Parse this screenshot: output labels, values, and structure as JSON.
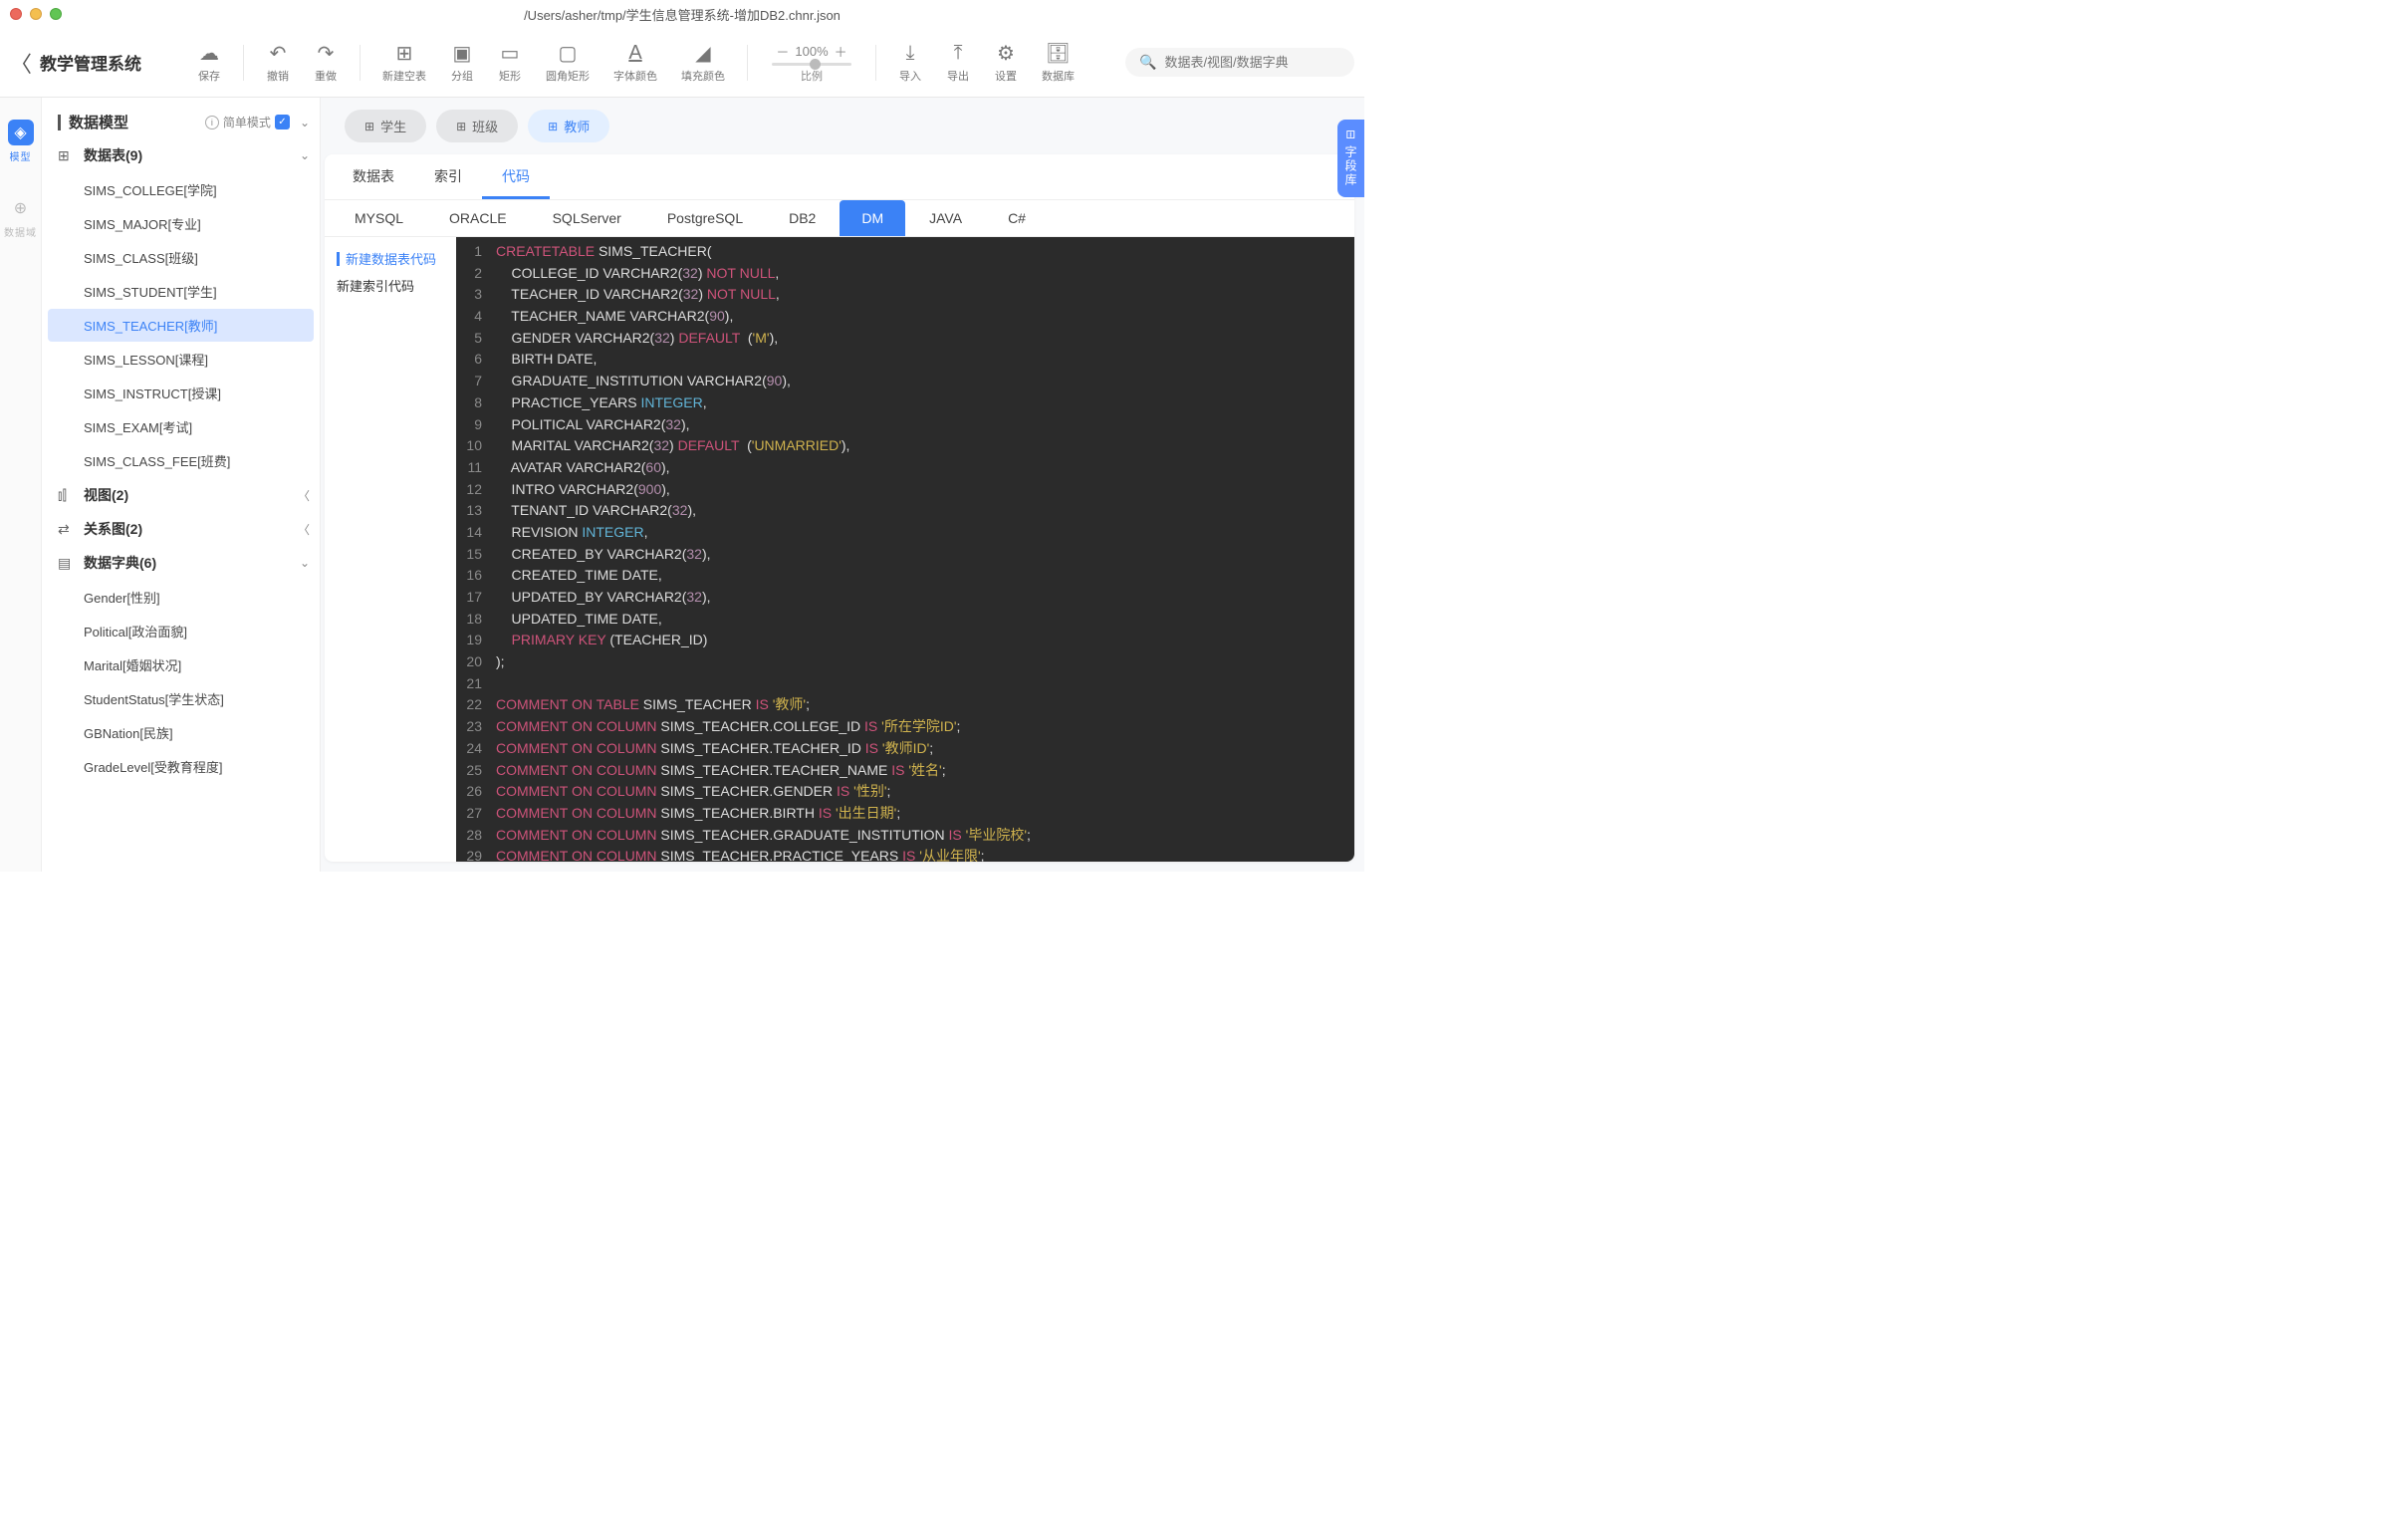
{
  "window": {
    "title": "/Users/asher/tmp/学生信息管理系统-增加DB2.chnr.json"
  },
  "back": {
    "title": "教学管理系统"
  },
  "toolbar": {
    "save": "保存",
    "undo": "撤销",
    "redo": "重做",
    "newtable": "新建空表",
    "group": "分组",
    "rect": "矩形",
    "roundrect": "圆角矩形",
    "fontcolor": "字体颜色",
    "fillcolor": "填充颜色",
    "zoom_label": "比例",
    "zoom_value": "100%",
    "import": "导入",
    "export": "导出",
    "settings": "设置",
    "database": "数据库"
  },
  "search": {
    "placeholder": "数据表/视图/数据字典"
  },
  "rail": {
    "model": "模型",
    "domain": "数据域"
  },
  "sidebar": {
    "header": "数据模型",
    "mode": "简单模式",
    "groups": {
      "tables": "数据表(9)",
      "views": "视图(2)",
      "relations": "关系图(2)",
      "dicts": "数据字典(6)"
    },
    "tables": [
      "SIMS_COLLEGE[学院]",
      "SIMS_MAJOR[专业]",
      "SIMS_CLASS[班级]",
      "SIMS_STUDENT[学生]",
      "SIMS_TEACHER[教师]",
      "SIMS_LESSON[课程]",
      "SIMS_INSTRUCT[授课]",
      "SIMS_EXAM[考试]",
      "SIMS_CLASS_FEE[班费]"
    ],
    "dicts": [
      "Gender[性别]",
      "Political[政治面貌]",
      "Marital[婚姻状况]",
      "StudentStatus[学生状态]",
      "GBNation[民族]",
      "GradeLevel[受教育程度]"
    ]
  },
  "pills": {
    "p1": "学生",
    "p2": "班级",
    "p3": "教师"
  },
  "tabs": {
    "t1": "数据表",
    "t2": "索引",
    "t3": "代码"
  },
  "dbs": [
    "MYSQL",
    "ORACLE",
    "SQLServer",
    "PostgreSQL",
    "DB2",
    "DM",
    "JAVA",
    "C#"
  ],
  "codeside": {
    "c1": "新建数据表代码",
    "c2": "新建索引代码"
  },
  "right_tab": "字段库",
  "code_lines": [
    [
      [
        "kw",
        "CREATE"
      ],
      [
        "",
        ""
      ],
      [
        "kw",
        "TABLE"
      ],
      [
        "",
        " SIMS_TEACHER("
      ]
    ],
    [
      [
        "",
        "    COLLEGE_ID VARCHAR2("
      ],
      [
        "num",
        "32"
      ],
      [
        "",
        ") "
      ],
      [
        "kw",
        "NOT"
      ],
      [
        "",
        " "
      ],
      [
        "kw",
        "NULL"
      ],
      [
        "",
        ","
      ]
    ],
    [
      [
        "",
        "    TEACHER_ID VARCHAR2("
      ],
      [
        "num",
        "32"
      ],
      [
        "",
        ") "
      ],
      [
        "kw",
        "NOT"
      ],
      [
        "",
        " "
      ],
      [
        "kw",
        "NULL"
      ],
      [
        "",
        ","
      ]
    ],
    [
      [
        "",
        "    TEACHER_NAME VARCHAR2("
      ],
      [
        "num",
        "90"
      ],
      [
        "",
        "),"
      ]
    ],
    [
      [
        "",
        "    GENDER VARCHAR2("
      ],
      [
        "num",
        "32"
      ],
      [
        "",
        ") "
      ],
      [
        "kw",
        "DEFAULT"
      ],
      [
        "",
        "  ("
      ],
      [
        "str",
        "'M'"
      ],
      [
        "",
        "),"
      ]
    ],
    [
      [
        "",
        "    BIRTH DATE,"
      ]
    ],
    [
      [
        "",
        "    GRADUATE_INSTITUTION VARCHAR2("
      ],
      [
        "num",
        "90"
      ],
      [
        "",
        "),"
      ]
    ],
    [
      [
        "",
        "    PRACTICE_YEARS "
      ],
      [
        "type",
        "INTEGER"
      ],
      [
        "",
        ","
      ]
    ],
    [
      [
        "",
        "    POLITICAL VARCHAR2("
      ],
      [
        "num",
        "32"
      ],
      [
        "",
        "),"
      ]
    ],
    [
      [
        "",
        "    MARITAL VARCHAR2("
      ],
      [
        "num",
        "32"
      ],
      [
        "",
        ") "
      ],
      [
        "kw",
        "DEFAULT"
      ],
      [
        "",
        "  ("
      ],
      [
        "str",
        "'UNMARRIED'"
      ],
      [
        "",
        "),"
      ]
    ],
    [
      [
        "",
        "    AVATAR VARCHAR2("
      ],
      [
        "num",
        "60"
      ],
      [
        "",
        "),"
      ]
    ],
    [
      [
        "",
        "    INTRO VARCHAR2("
      ],
      [
        "num",
        "900"
      ],
      [
        "",
        "),"
      ]
    ],
    [
      [
        "",
        "    TENANT_ID VARCHAR2("
      ],
      [
        "num",
        "32"
      ],
      [
        "",
        "),"
      ]
    ],
    [
      [
        "",
        "    REVISION "
      ],
      [
        "type",
        "INTEGER"
      ],
      [
        "",
        ","
      ]
    ],
    [
      [
        "",
        "    CREATED_BY VARCHAR2("
      ],
      [
        "num",
        "32"
      ],
      [
        "",
        "),"
      ]
    ],
    [
      [
        "",
        "    CREATED_TIME DATE,"
      ]
    ],
    [
      [
        "",
        "    UPDATED_BY VARCHAR2("
      ],
      [
        "num",
        "32"
      ],
      [
        "",
        "),"
      ]
    ],
    [
      [
        "",
        "    UPDATED_TIME DATE,"
      ]
    ],
    [
      [
        "",
        "    "
      ],
      [
        "kw",
        "PRIMARY"
      ],
      [
        "",
        " "
      ],
      [
        "kw",
        "KEY"
      ],
      [
        "",
        " (TEACHER_ID)"
      ]
    ],
    [
      [
        "",
        ");"
      ]
    ],
    [
      [
        "",
        ""
      ]
    ],
    [
      [
        "kw",
        "COMMENT"
      ],
      [
        "",
        " "
      ],
      [
        "kw",
        "ON"
      ],
      [
        "",
        " "
      ],
      [
        "kw",
        "TABLE"
      ],
      [
        "",
        " SIMS_TEACHER "
      ],
      [
        "kw",
        "IS"
      ],
      [
        "",
        " "
      ],
      [
        "str",
        "'教师'"
      ],
      [
        "",
        ";"
      ]
    ],
    [
      [
        "kw",
        "COMMENT"
      ],
      [
        "",
        " "
      ],
      [
        "kw",
        "ON"
      ],
      [
        "",
        " "
      ],
      [
        "kw",
        "COLUMN"
      ],
      [
        "",
        " SIMS_TEACHER.COLLEGE_ID "
      ],
      [
        "kw",
        "IS"
      ],
      [
        "",
        " "
      ],
      [
        "str",
        "'所在学院ID'"
      ],
      [
        "",
        ";"
      ]
    ],
    [
      [
        "kw",
        "COMMENT"
      ],
      [
        "",
        " "
      ],
      [
        "kw",
        "ON"
      ],
      [
        "",
        " "
      ],
      [
        "kw",
        "COLUMN"
      ],
      [
        "",
        " SIMS_TEACHER.TEACHER_ID "
      ],
      [
        "kw",
        "IS"
      ],
      [
        "",
        " "
      ],
      [
        "str",
        "'教师ID'"
      ],
      [
        "",
        ";"
      ]
    ],
    [
      [
        "kw",
        "COMMENT"
      ],
      [
        "",
        " "
      ],
      [
        "kw",
        "ON"
      ],
      [
        "",
        " "
      ],
      [
        "kw",
        "COLUMN"
      ],
      [
        "",
        " SIMS_TEACHER.TEACHER_NAME "
      ],
      [
        "kw",
        "IS"
      ],
      [
        "",
        " "
      ],
      [
        "str",
        "'姓名'"
      ],
      [
        "",
        ";"
      ]
    ],
    [
      [
        "kw",
        "COMMENT"
      ],
      [
        "",
        " "
      ],
      [
        "kw",
        "ON"
      ],
      [
        "",
        " "
      ],
      [
        "kw",
        "COLUMN"
      ],
      [
        "",
        " SIMS_TEACHER.GENDER "
      ],
      [
        "kw",
        "IS"
      ],
      [
        "",
        " "
      ],
      [
        "str",
        "'性别'"
      ],
      [
        "",
        ";"
      ]
    ],
    [
      [
        "kw",
        "COMMENT"
      ],
      [
        "",
        " "
      ],
      [
        "kw",
        "ON"
      ],
      [
        "",
        " "
      ],
      [
        "kw",
        "COLUMN"
      ],
      [
        "",
        " SIMS_TEACHER.BIRTH "
      ],
      [
        "kw",
        "IS"
      ],
      [
        "",
        " "
      ],
      [
        "str",
        "'出生日期'"
      ],
      [
        "",
        ";"
      ]
    ],
    [
      [
        "kw",
        "COMMENT"
      ],
      [
        "",
        " "
      ],
      [
        "kw",
        "ON"
      ],
      [
        "",
        " "
      ],
      [
        "kw",
        "COLUMN"
      ],
      [
        "",
        " SIMS_TEACHER.GRADUATE_INSTITUTION "
      ],
      [
        "kw",
        "IS"
      ],
      [
        "",
        " "
      ],
      [
        "str",
        "'毕业院校'"
      ],
      [
        "",
        ";"
      ]
    ],
    [
      [
        "kw",
        "COMMENT"
      ],
      [
        "",
        " "
      ],
      [
        "kw",
        "ON"
      ],
      [
        "",
        " "
      ],
      [
        "kw",
        "COLUMN"
      ],
      [
        "",
        " SIMS_TEACHER.PRACTICE_YEARS "
      ],
      [
        "kw",
        "IS"
      ],
      [
        "",
        " "
      ],
      [
        "str",
        "'从业年限'"
      ],
      [
        "",
        ";"
      ]
    ]
  ]
}
